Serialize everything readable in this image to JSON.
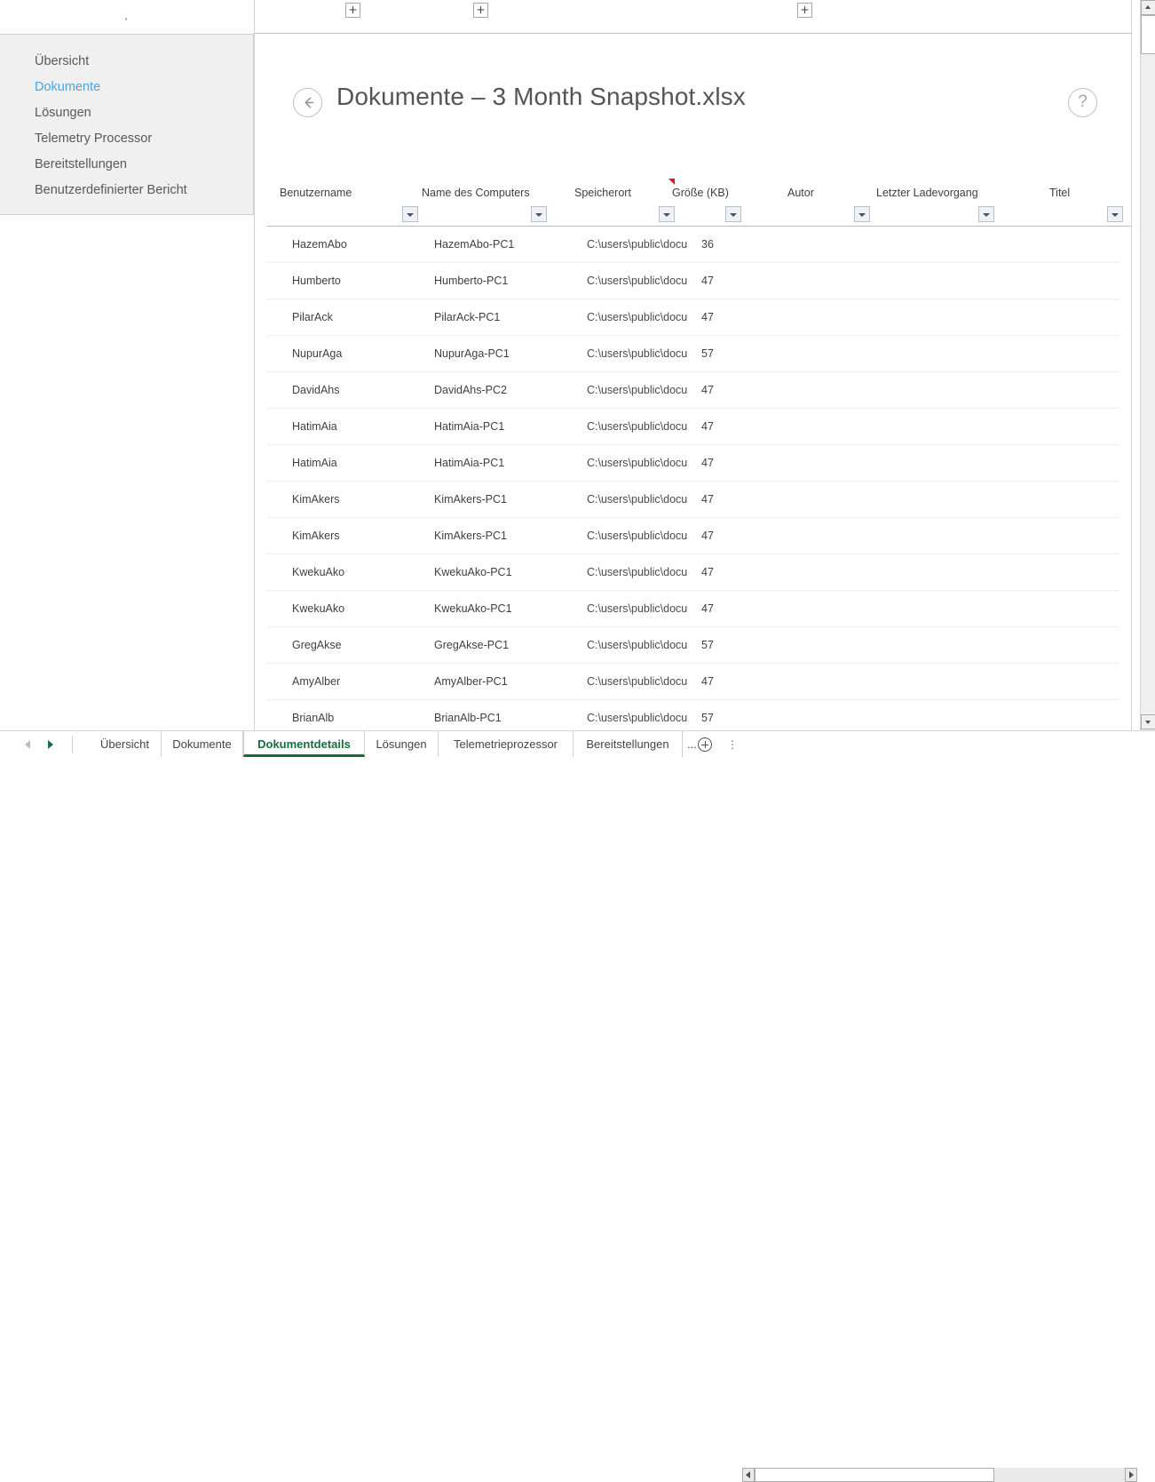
{
  "window": {
    "title": "Dokumente – 3 Month Snapshot.xlsx"
  },
  "worksheet": {
    "group_plus_label": "+",
    "active_cell_value": ""
  },
  "nav_panel": {
    "items": [
      {
        "label": "Übersicht",
        "current": false
      },
      {
        "label": "Dokumente",
        "current": true
      },
      {
        "label": "Lösungen",
        "current": false
      },
      {
        "label": "Telemetry Processor",
        "current": false
      },
      {
        "label": "Bereitstellungen",
        "current": false
      },
      {
        "label": "Benutzerdefinierter Bericht",
        "current": false
      }
    ],
    "accent_color": "#4ca3dd"
  },
  "report": {
    "title": "Dokumente – 3 Month Snapshot.xlsx",
    "back_label": "Zurück",
    "help_label": "?",
    "columns": [
      {
        "label": "Benutzername",
        "has_filter": true,
        "has_comment": false
      },
      {
        "label": "Name des Computers",
        "has_filter": true,
        "has_comment": false
      },
      {
        "label": "Speicherort",
        "has_filter": true,
        "has_comment": false
      },
      {
        "label": "Größe (KB)",
        "has_filter": true,
        "has_comment": true
      },
      {
        "label": "Autor",
        "has_filter": true,
        "has_comment": false
      },
      {
        "label": "Letzter Ladevorgang",
        "has_filter": true,
        "has_comment": false
      },
      {
        "label": "Titel",
        "has_filter": true,
        "has_comment": false
      }
    ],
    "rows": [
      {
        "benutzername": "HazemAbo",
        "computer": "HazemAbo-PC1",
        "speicherort": "C:\\users\\public\\docu",
        "groesse": "36",
        "autor": "",
        "ladevorgang": "",
        "titel": ""
      },
      {
        "benutzername": "Humberto",
        "computer": "Humberto-PC1",
        "speicherort": "C:\\users\\public\\docu",
        "groesse": "47",
        "autor": "",
        "ladevorgang": "",
        "titel": ""
      },
      {
        "benutzername": "PilarAck",
        "computer": "PilarAck-PC1",
        "speicherort": "C:\\users\\public\\docu",
        "groesse": "47",
        "autor": "",
        "ladevorgang": "",
        "titel": ""
      },
      {
        "benutzername": "NupurAga",
        "computer": "NupurAga-PC1",
        "speicherort": "C:\\users\\public\\docu",
        "groesse": "57",
        "autor": "",
        "ladevorgang": "",
        "titel": ""
      },
      {
        "benutzername": "DavidAhs",
        "computer": "DavidAhs-PC2",
        "speicherort": "C:\\users\\public\\docu",
        "groesse": "47",
        "autor": "",
        "ladevorgang": "",
        "titel": ""
      },
      {
        "benutzername": "HatimAia",
        "computer": "HatimAia-PC1",
        "speicherort": "C:\\users\\public\\docu",
        "groesse": "47",
        "autor": "",
        "ladevorgang": "",
        "titel": ""
      },
      {
        "benutzername": "HatimAia",
        "computer": "HatimAia-PC1",
        "speicherort": "C:\\users\\public\\docu",
        "groesse": "47",
        "autor": "",
        "ladevorgang": "",
        "titel": ""
      },
      {
        "benutzername": "KimAkers",
        "computer": "KimAkers-PC1",
        "speicherort": "C:\\users\\public\\docu",
        "groesse": "47",
        "autor": "",
        "ladevorgang": "",
        "titel": ""
      },
      {
        "benutzername": "KimAkers",
        "computer": "KimAkers-PC1",
        "speicherort": "C:\\users\\public\\docu",
        "groesse": "47",
        "autor": "",
        "ladevorgang": "",
        "titel": ""
      },
      {
        "benutzername": "KwekuAko",
        "computer": "KwekuAko-PC1",
        "speicherort": "C:\\users\\public\\docu",
        "groesse": "47",
        "autor": "",
        "ladevorgang": "",
        "titel": ""
      },
      {
        "benutzername": "KwekuAko",
        "computer": "KwekuAko-PC1",
        "speicherort": "C:\\users\\public\\docu",
        "groesse": "47",
        "autor": "",
        "ladevorgang": "",
        "titel": ""
      },
      {
        "benutzername": "GregAkse",
        "computer": "GregAkse-PC1",
        "speicherort": "C:\\users\\public\\docu",
        "groesse": "57",
        "autor": "",
        "ladevorgang": "",
        "titel": ""
      },
      {
        "benutzername": "AmyAlber",
        "computer": "AmyAlber-PC1",
        "speicherort": "C:\\users\\public\\docu",
        "groesse": "47",
        "autor": "",
        "ladevorgang": "",
        "titel": ""
      },
      {
        "benutzername": "BrianAlb",
        "computer": "BrianAlb-PC1",
        "speicherort": "C:\\users\\public\\docu",
        "groesse": "57",
        "autor": "",
        "ladevorgang": "",
        "titel": ""
      }
    ]
  },
  "tabbar": {
    "sheets": [
      {
        "label": "Übersicht",
        "active": false
      },
      {
        "label": "Dokumente",
        "active": false
      },
      {
        "label": "Dokumentdetails",
        "active": true
      },
      {
        "label": "Lösungen",
        "active": false
      },
      {
        "label": "Telemetrieprozessor",
        "active": false
      },
      {
        "label": "Bereitstellungen",
        "active": false
      }
    ],
    "overflow_label": "...",
    "add_sheet_label": "+",
    "options_label": "⋮",
    "active_color": "#176c3c"
  }
}
